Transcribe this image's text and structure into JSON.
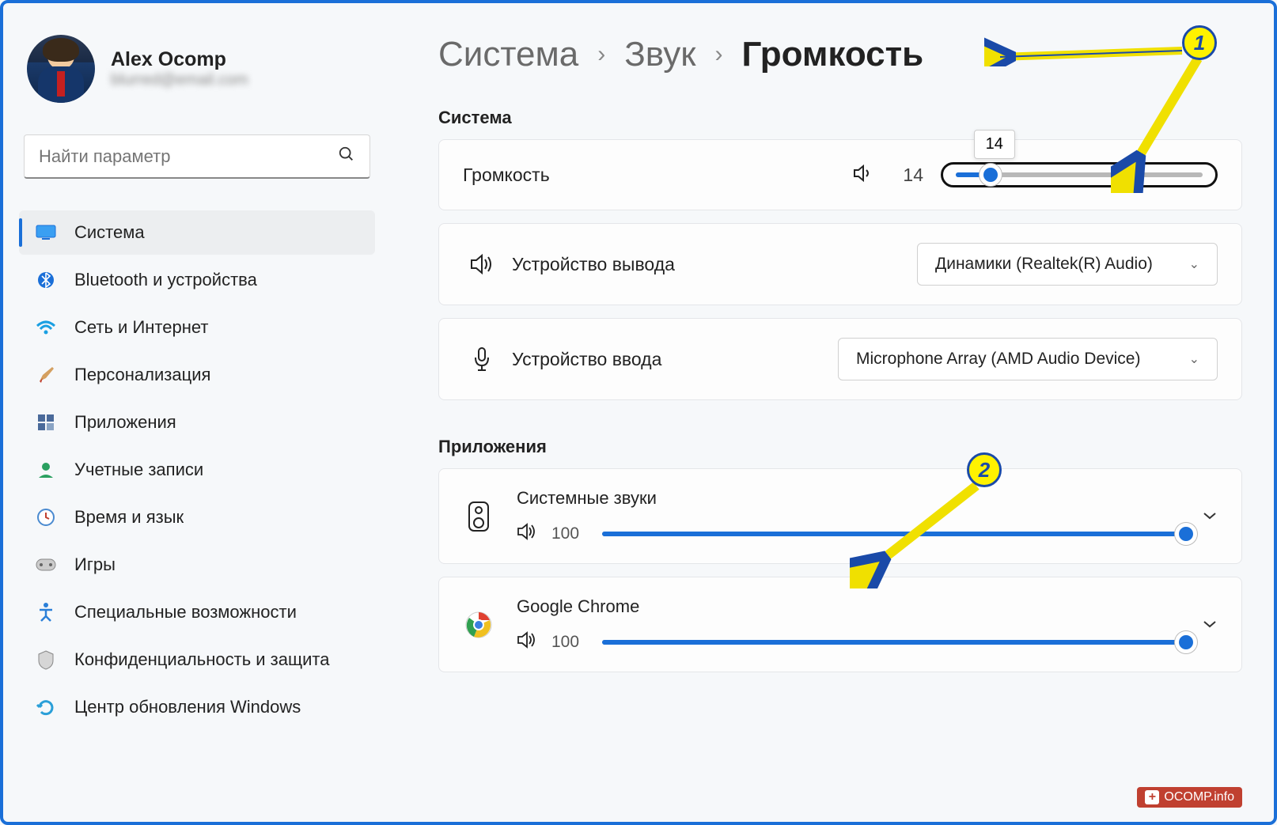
{
  "profile": {
    "name": "Alex Ocomp",
    "email": "blurred@email.com"
  },
  "search": {
    "placeholder": "Найти параметр"
  },
  "nav": [
    {
      "label": "Система",
      "icon": "monitor",
      "active": true
    },
    {
      "label": "Bluetooth и устройства",
      "icon": "bluetooth"
    },
    {
      "label": "Сеть и Интернет",
      "icon": "wifi"
    },
    {
      "label": "Персонализация",
      "icon": "brush"
    },
    {
      "label": "Приложения",
      "icon": "apps"
    },
    {
      "label": "Учетные записи",
      "icon": "account"
    },
    {
      "label": "Время и язык",
      "icon": "clock"
    },
    {
      "label": "Игры",
      "icon": "gamepad"
    },
    {
      "label": "Специальные возможности",
      "icon": "accessibility"
    },
    {
      "label": "Конфиденциальность и защита",
      "icon": "shield"
    },
    {
      "label": "Центр обновления Windows",
      "icon": "update"
    }
  ],
  "breadcrumb": {
    "root": "Система",
    "mid": "Звук",
    "current": "Громкость"
  },
  "sections": {
    "system_title": "Система",
    "apps_title": "Приложения"
  },
  "volume": {
    "label": "Громкость",
    "value": "14",
    "tooltip": "14",
    "percent": 14
  },
  "output": {
    "label": "Устройство вывода",
    "device": "Динамики (Realtek(R) Audio)"
  },
  "input": {
    "label": "Устройство ввода",
    "device": "Microphone Array (AMD Audio Device)"
  },
  "apps": [
    {
      "name": "Системные звуки",
      "value": "100",
      "percent": 100,
      "icon": "system-sound"
    },
    {
      "name": "Google Chrome",
      "value": "100",
      "percent": 100,
      "icon": "chrome"
    }
  ],
  "annotations": {
    "badge1": "1",
    "badge2": "2"
  },
  "watermark": "OCOMP.info"
}
